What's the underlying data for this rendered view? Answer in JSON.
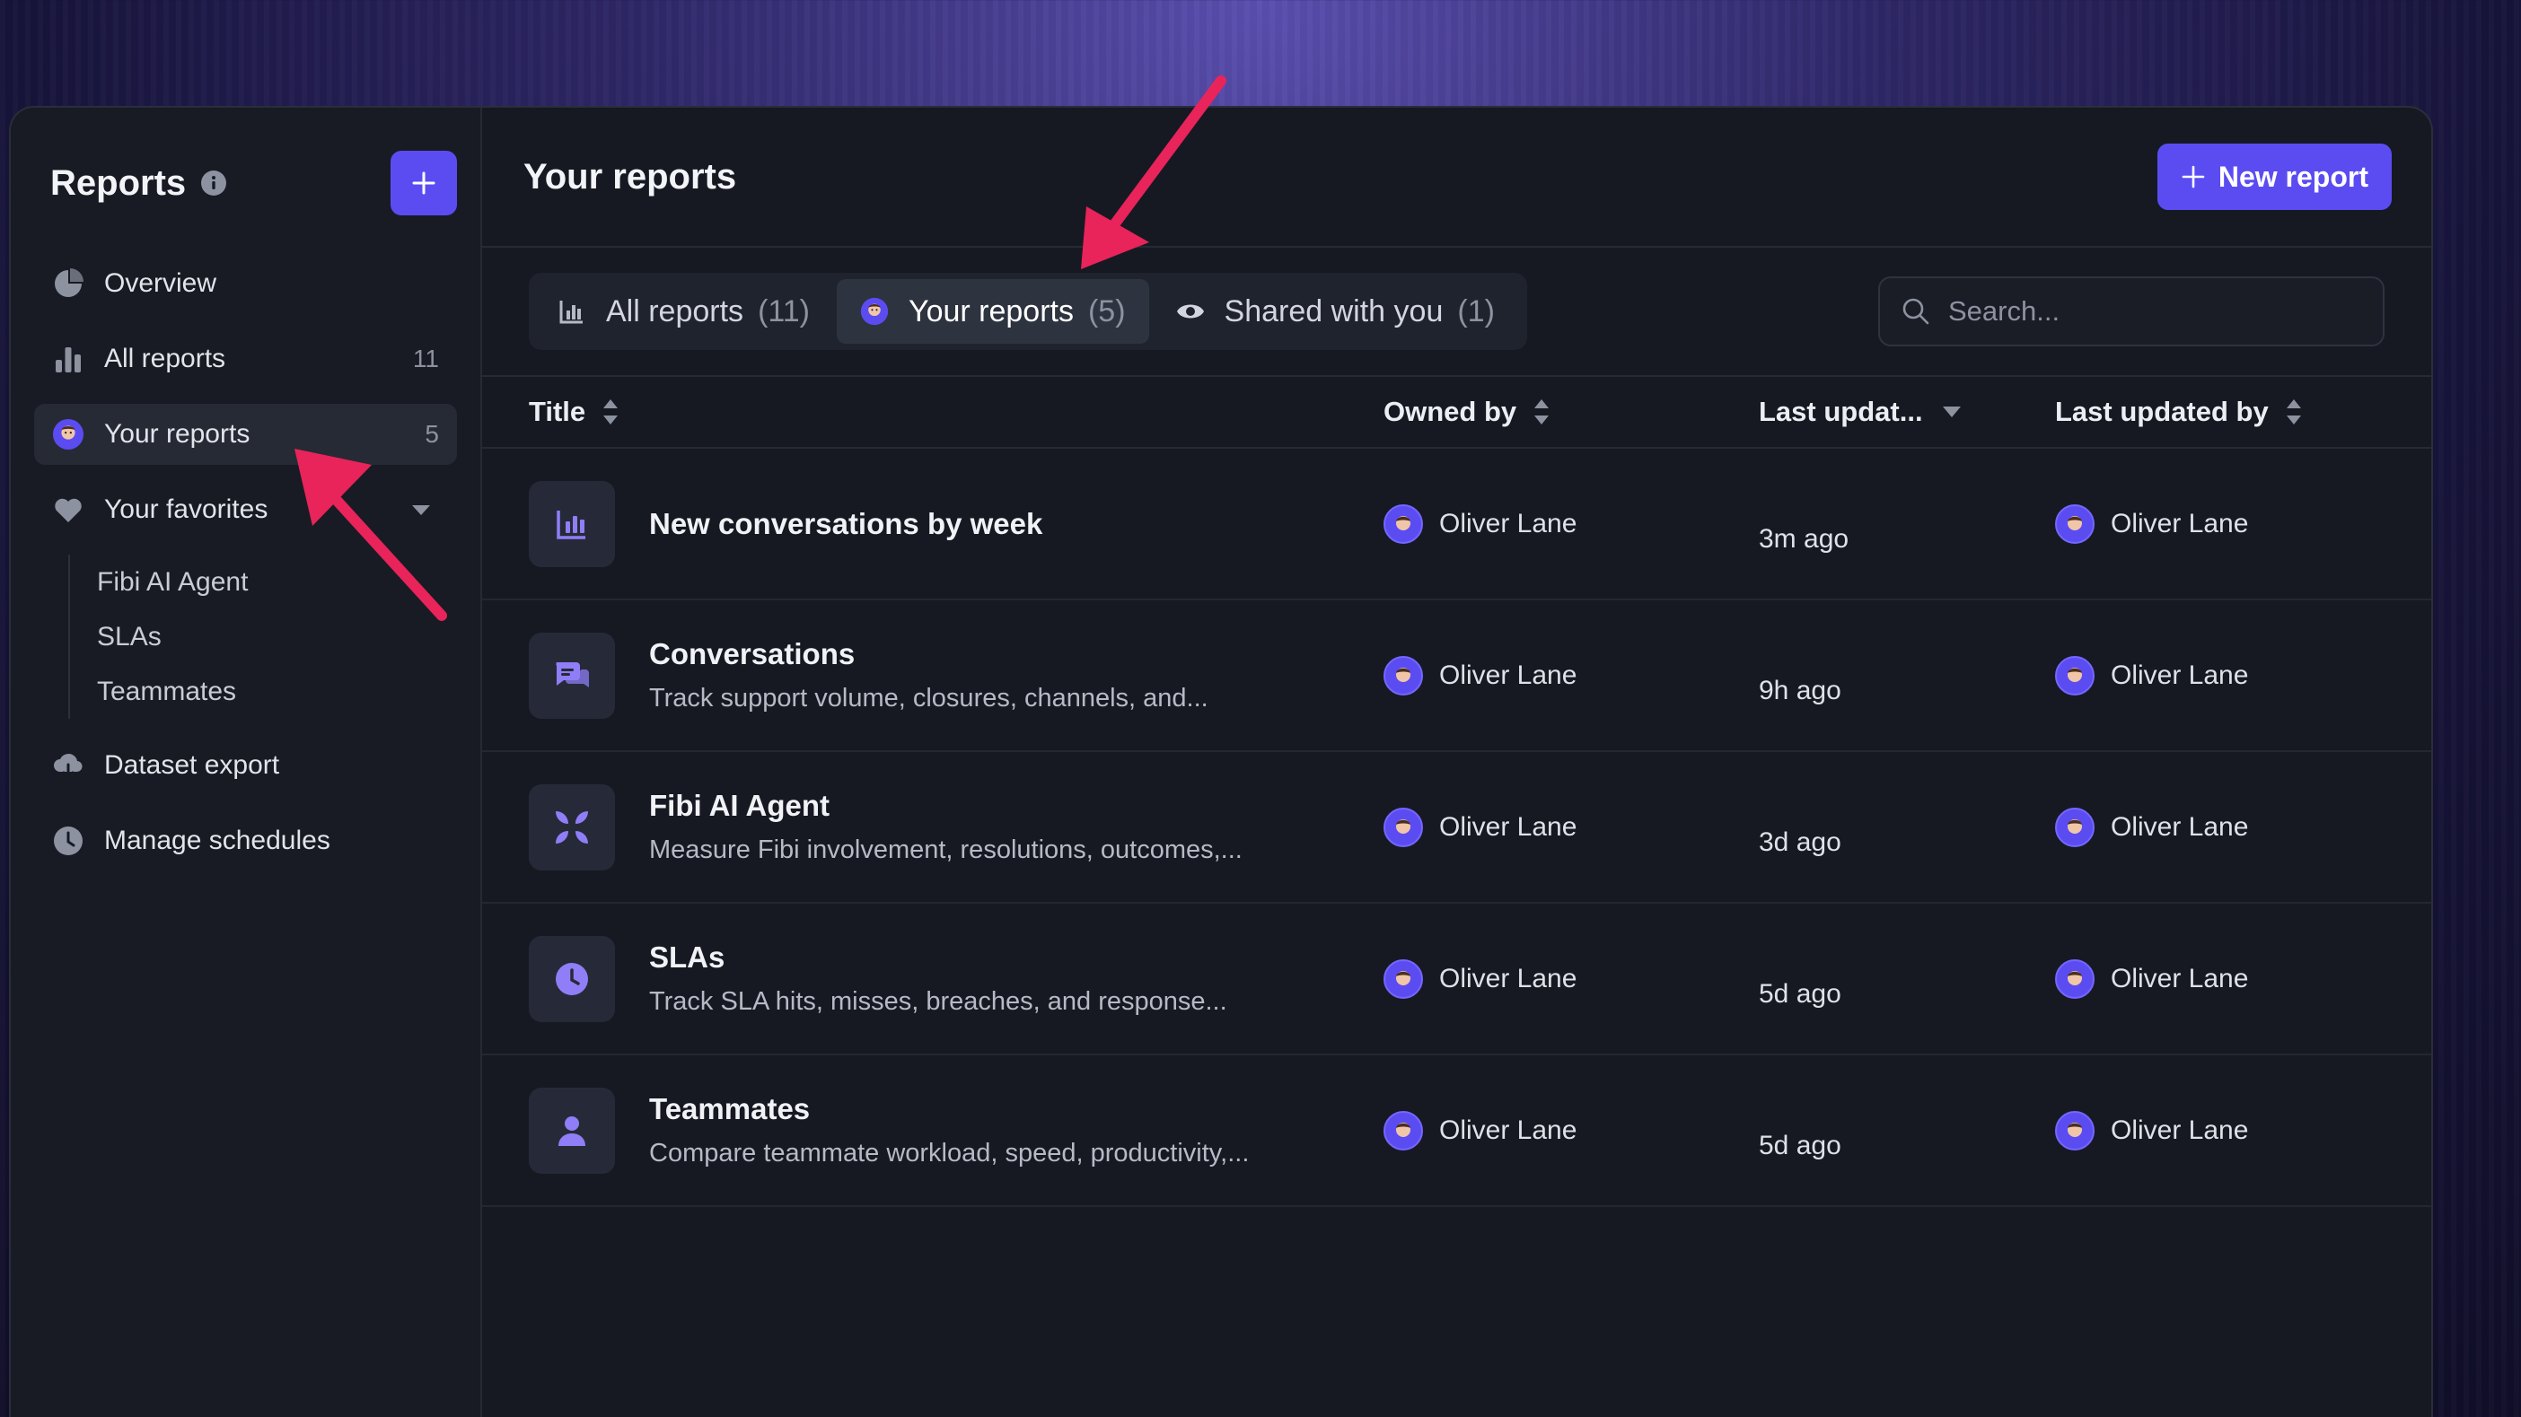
{
  "colors": {
    "accent": "#5b4cf2",
    "arrow": "#e8245a",
    "panel": "#161922"
  },
  "sidebar": {
    "title": "Reports",
    "info_icon": "info-icon",
    "add_icon": "plus-icon",
    "items": [
      {
        "label": "Overview",
        "icon": "pie-chart-icon",
        "count": ""
      },
      {
        "label": "All reports",
        "icon": "bar-chart-icon",
        "count": "11"
      },
      {
        "label": "Your reports",
        "icon": "avatar-icon",
        "count": "5"
      },
      {
        "label": "Your favorites",
        "icon": "heart-icon",
        "count": ""
      },
      {
        "label": "Dataset export",
        "icon": "cloud-download-icon",
        "count": ""
      },
      {
        "label": "Manage schedules",
        "icon": "clock-icon",
        "count": ""
      }
    ],
    "favorites": [
      "Fibi AI Agent",
      "SLAs",
      "Teammates"
    ]
  },
  "header": {
    "title": "Your reports",
    "new_report_label": "New report"
  },
  "tabs": [
    {
      "label": "All reports",
      "count": "(11)",
      "icon": "bar-chart-icon"
    },
    {
      "label": "Your reports",
      "count": "(5)",
      "icon": "avatar-icon"
    },
    {
      "label": "Shared with you",
      "count": "(1)",
      "icon": "eye-icon"
    }
  ],
  "search": {
    "placeholder": "Search..."
  },
  "table": {
    "columns": [
      "Title",
      "Owned by",
      "Last updat...",
      "Last updated by"
    ],
    "rows": [
      {
        "icon": "bar-chart-icon",
        "title": "New conversations by week",
        "desc": "",
        "owner": "Oliver Lane",
        "updated": "3m ago",
        "updated_by": "Oliver Lane"
      },
      {
        "icon": "chat-bubbles-icon",
        "title": "Conversations",
        "desc": "Track support volume, closures, channels, and...",
        "owner": "Oliver Lane",
        "updated": "9h ago",
        "updated_by": "Oliver Lane"
      },
      {
        "icon": "fibi-logo-icon",
        "title": "Fibi AI Agent",
        "desc": "Measure Fibi involvement, resolutions, outcomes,...",
        "owner": "Oliver Lane",
        "updated": "3d ago",
        "updated_by": "Oliver Lane"
      },
      {
        "icon": "clock-icon",
        "title": "SLAs",
        "desc": "Track SLA hits, misses, breaches, and response...",
        "owner": "Oliver Lane",
        "updated": "5d ago",
        "updated_by": "Oliver Lane"
      },
      {
        "icon": "person-icon",
        "title": "Teammates",
        "desc": "Compare teammate workload, speed, productivity,...",
        "owner": "Oliver Lane",
        "updated": "5d ago",
        "updated_by": "Oliver Lane"
      }
    ]
  }
}
